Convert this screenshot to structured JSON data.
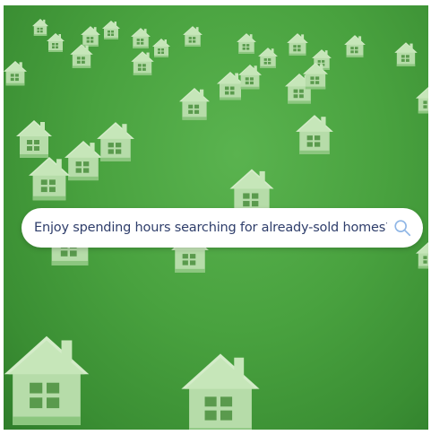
{
  "search": {
    "query_text": "Enjoy spending hours searching for already-sold homes?",
    "icon": "search-icon"
  },
  "background": {
    "subject": "house-icons-field",
    "colors": {
      "field": "#49a23f",
      "house": "#b9dfae",
      "house_shadow": "#8cc67f"
    }
  },
  "colors": {
    "search_text": "#2f3e6b",
    "search_icon": "#8fb6e6",
    "search_background": "#ffffff"
  }
}
